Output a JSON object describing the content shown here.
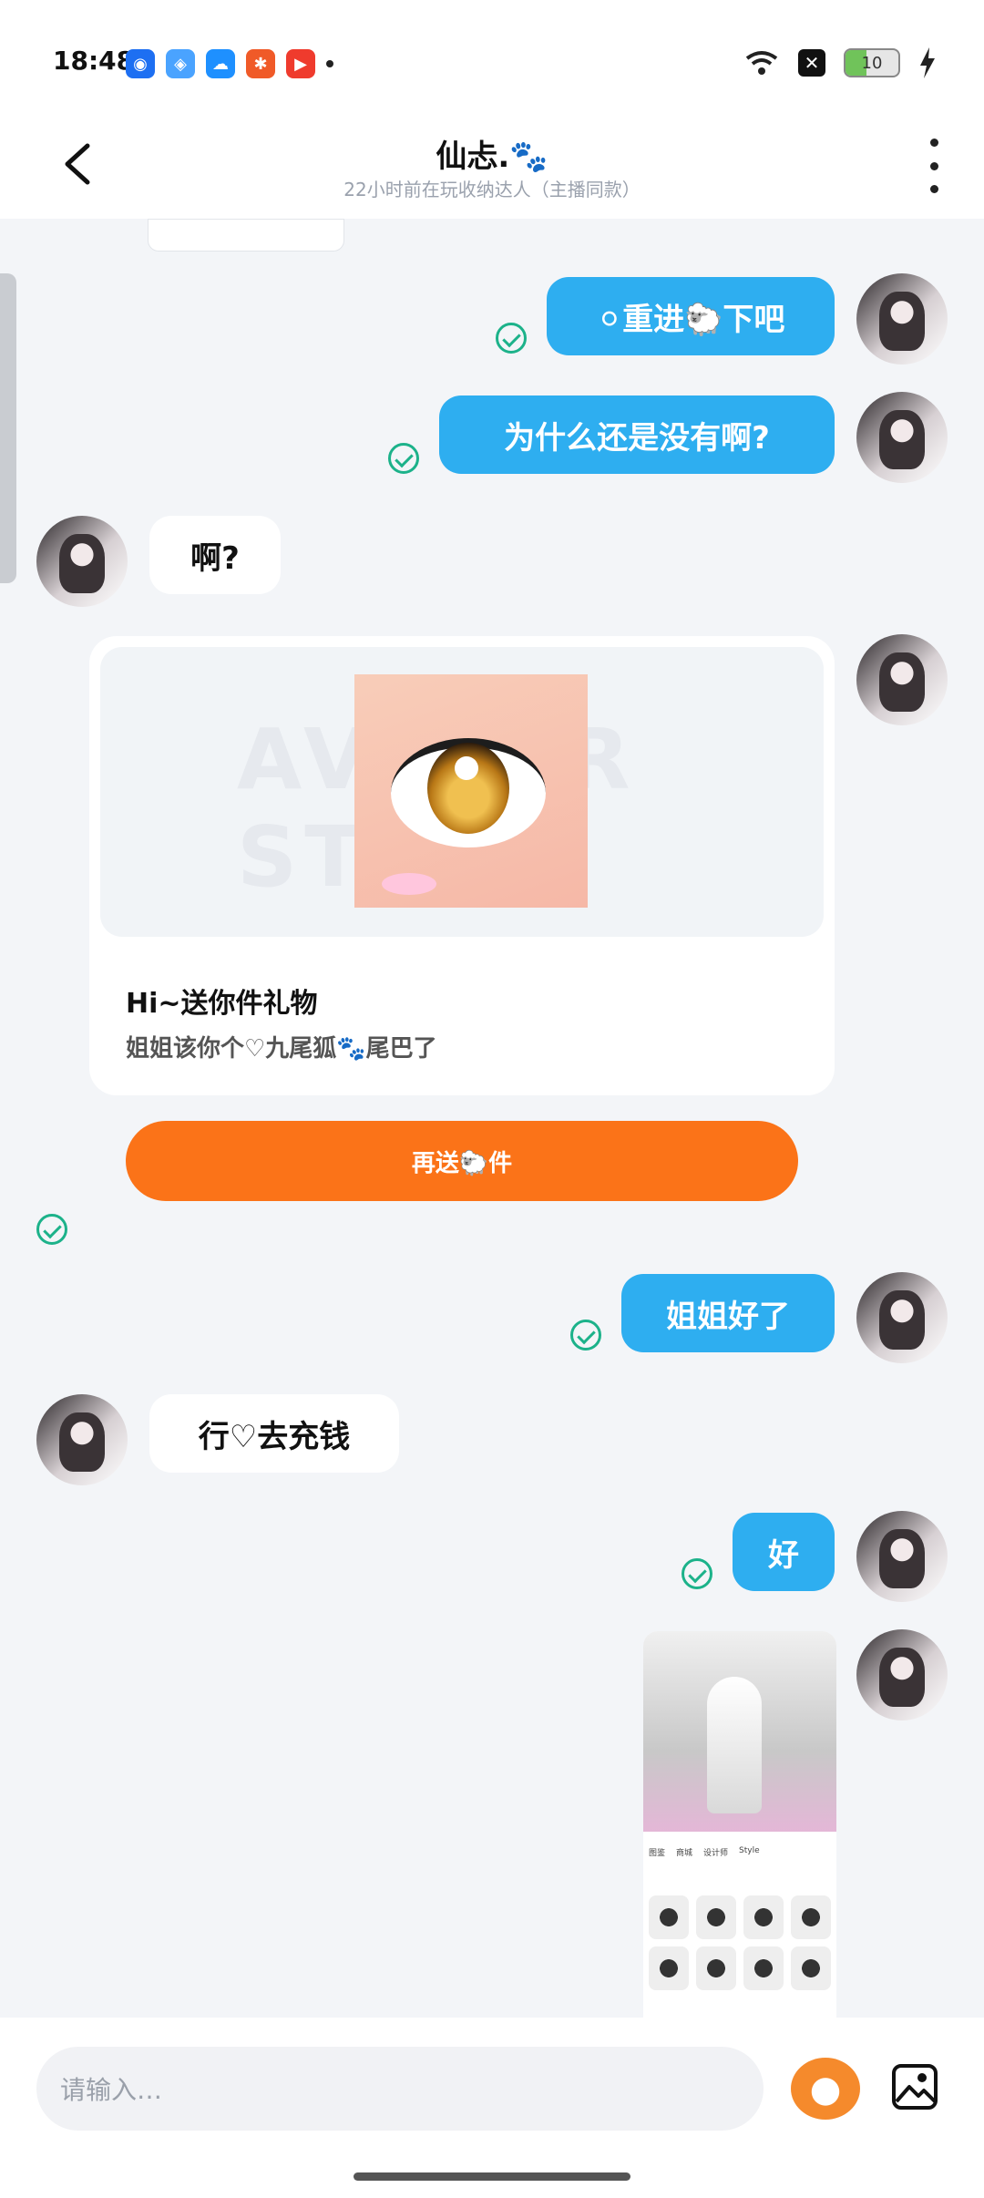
{
  "status_bar": {
    "time": "18:48",
    "battery": "10",
    "app_icons": [
      "map-app-icon",
      "browser-app-icon",
      "cloud-app-icon",
      "star-app-icon",
      "video-app-icon"
    ]
  },
  "header": {
    "title": "仙忐.🐾",
    "subtitle": "22小时前在玩收纳达人（主播同款）"
  },
  "messages": [
    {
      "from": "me",
      "text": "⚪重进🐑下吧"
    },
    {
      "from": "me",
      "text": "为什么还是没有啊?"
    },
    {
      "from": "other",
      "text": "啊?"
    },
    {
      "from": "other",
      "type": "gift",
      "title": "Hi~送你件礼物",
      "desc": "姐姐该你个♡九尾狐🐾尾巴了",
      "button": "再送🐑件"
    },
    {
      "from": "me",
      "text": "姐姐好了"
    },
    {
      "from": "other",
      "text": "行♡去充钱"
    },
    {
      "from": "me",
      "text": "好"
    },
    {
      "from": "me",
      "type": "image"
    }
  ],
  "gift_watermark": "AVATAR STORE",
  "input": {
    "placeholder": "请输入…"
  },
  "colors": {
    "my_bubble": "#2eaef0",
    "other_bubble": "#ffffff",
    "button_orange": "#fb7318",
    "check_green": "#1cb28a",
    "background": "#f3f5f8"
  }
}
